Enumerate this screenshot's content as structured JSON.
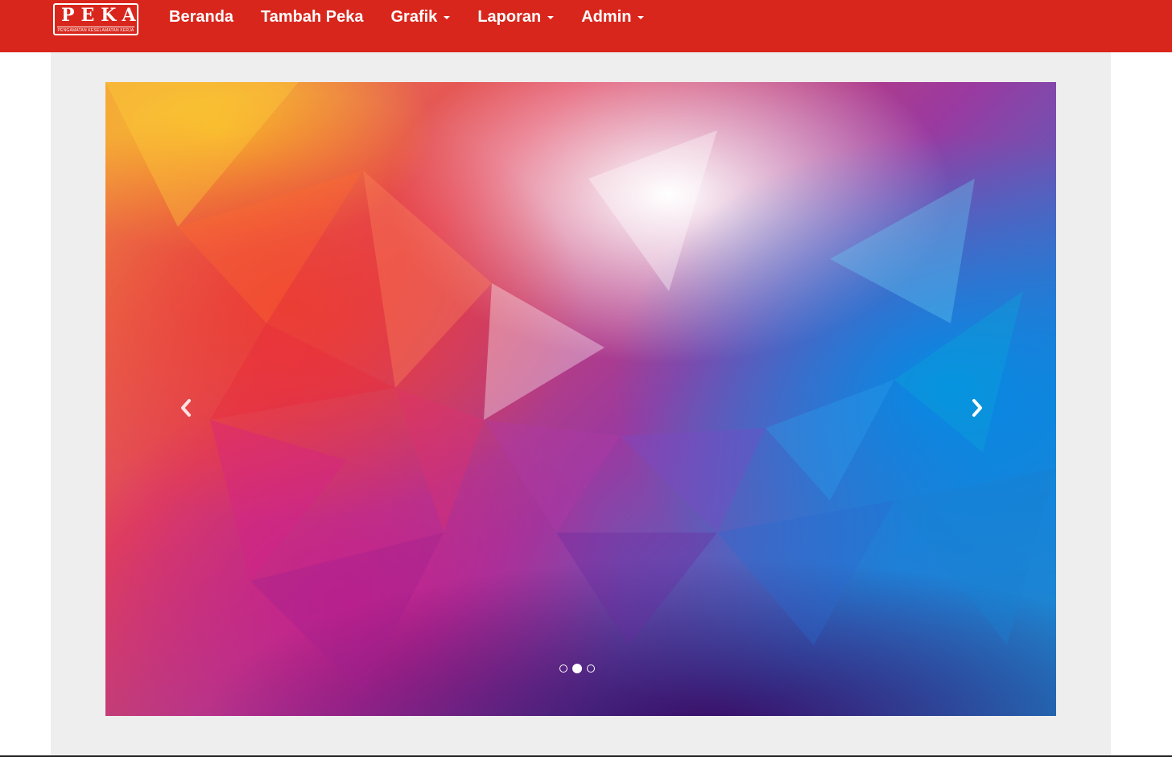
{
  "brand": {
    "title": "PEKA",
    "subtitle": "PENGAMATAN KESELAMATAN KERJA",
    "icon": "peka-logo"
  },
  "nav": {
    "items": [
      {
        "label": "Beranda",
        "dropdown": false
      },
      {
        "label": "Tambah Peka",
        "dropdown": false
      },
      {
        "label": "Grafik",
        "dropdown": true
      },
      {
        "label": "Laporan",
        "dropdown": true
      },
      {
        "label": "Admin",
        "dropdown": true
      }
    ]
  },
  "carousel": {
    "slide_count": 3,
    "active_index": 1,
    "prev_icon": "chevron-left-icon",
    "next_icon": "chevron-right-icon"
  },
  "colors": {
    "navbar": "#d9261c",
    "container": "#eeeeee",
    "text_on_nav": "#ffffff"
  }
}
